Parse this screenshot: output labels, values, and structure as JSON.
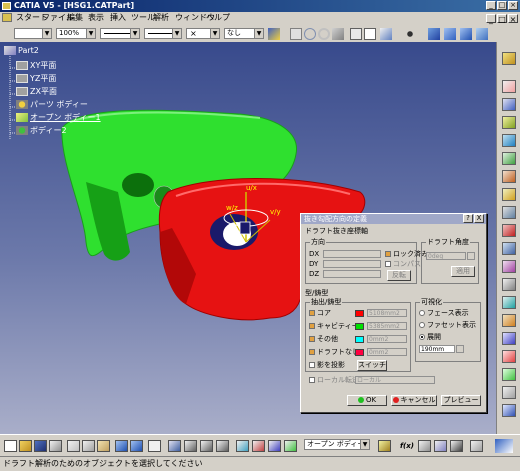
{
  "window": {
    "title": "CATIA V5 - [HSG1.CATPart]"
  },
  "menu": {
    "items": [
      "スタート",
      "ファイル",
      "編集",
      "表示",
      "挿入",
      "ツール",
      "解析",
      "ウィンドウ",
      "ヘルプ"
    ]
  },
  "toolbar": {
    "zoom_value": "100%",
    "layer_value": "なし"
  },
  "tree": {
    "root": "Part2",
    "items": [
      "XY平面",
      "YZ平面",
      "ZX平面",
      "パーツ ボディー",
      "オープン ボディー1",
      "ボディー2"
    ]
  },
  "compass": {
    "u_label": "u/x",
    "v_label": "v/y",
    "w_label": "w/z"
  },
  "dialog": {
    "title": "抜き勾配方向の定義",
    "help_btn": "?",
    "close_btn": "X",
    "section_draft": "ドラフト抜き座標軸",
    "group_direction": "方向",
    "dx_label": "DX",
    "dy_label": "DY",
    "dz_label": "DZ",
    "lock_label": "ロック済み",
    "compass_label": "コンパス",
    "reverse_btn": "反転",
    "group_angle": "ドラフト角度",
    "angle_value": "0deg",
    "angle_btn": "適用",
    "group_mold": "型/鋳型",
    "group_extract": "抽出/鋳型",
    "row_core": "コア",
    "row_cavity": "キャビティー",
    "row_other": "その他",
    "row_nodraft": "ドラフトなし",
    "area_core": "5108mm2",
    "area_cavity": "5385mm2",
    "area_other": "0mm2",
    "area_nodraft": "0mm2",
    "core_color": "#ff0000",
    "cavity_color": "#00e000",
    "other_color": "#00ffff",
    "nodraft_color": "#ff0040",
    "shadow_label": "影を投影",
    "switch_btn": "スイッチ",
    "group_visual": "可視化",
    "vis_face": "フェース表示",
    "vis_facet": "ファセット表示",
    "vis_expand": "展開",
    "vis_value": "190mm",
    "local_label": "ローカル転送",
    "local_value": "ローカル",
    "ok_label": "OK",
    "cancel_label": "キャンセル",
    "preview_label": "プレビュー"
  },
  "bottom": {
    "body_select": "オープン ボディー1",
    "fog_label": "f(x)"
  },
  "status": {
    "text": "ドラフト解析のためのオブジェクトを選択してください"
  }
}
